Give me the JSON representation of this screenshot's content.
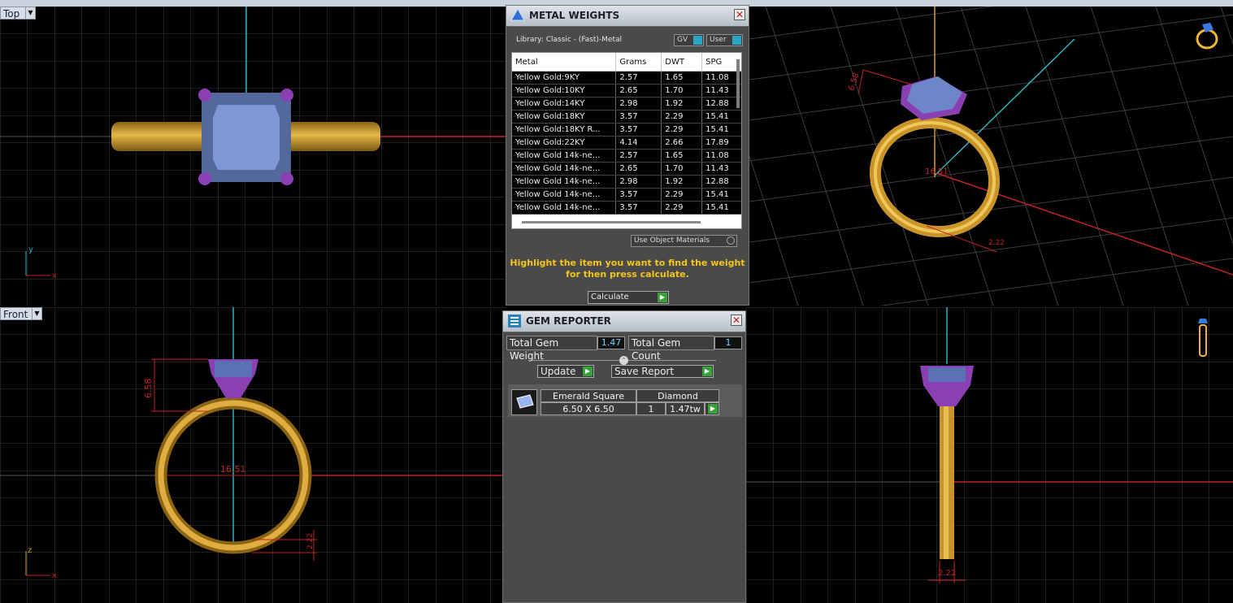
{
  "viewports": {
    "top_label": "Top",
    "front_label": "Front",
    "axis_x": "x",
    "axis_y": "y",
    "axis_z": "z"
  },
  "dimensions": {
    "front_height": "6.58",
    "front_width": "16.51",
    "persp_height": "6.58",
    "persp_width": "16.51",
    "persp_band": "2.22",
    "side_band": "2.22"
  },
  "metal_weights": {
    "title": "METAL WEIGHTS",
    "library": "Library: Classic - (Fast)-Metal",
    "gv_label": "GV",
    "user_label": "User",
    "columns": [
      "Metal",
      "Grams",
      "DWT",
      "SPG"
    ],
    "rows": [
      [
        "Yellow Gold:9KY",
        "2.57",
        "1.65",
        "11.08"
      ],
      [
        "Yellow Gold:10KY",
        "2.65",
        "1.70",
        "11.43"
      ],
      [
        "Yellow Gold:14KY",
        "2.98",
        "1.92",
        "12.88"
      ],
      [
        "Yellow Gold:18KY",
        "3.57",
        "2.29",
        "15.41"
      ],
      [
        "Yellow Gold:18KY R...",
        "3.57",
        "2.29",
        "15.41"
      ],
      [
        "Yellow Gold:22KY",
        "4.14",
        "2.66",
        "17.89"
      ],
      [
        "Yellow Gold 14k-ne...",
        "2.57",
        "1.65",
        "11.08"
      ],
      [
        "Yellow Gold 14k-ne...",
        "2.65",
        "1.70",
        "11.43"
      ],
      [
        "Yellow Gold 14k-ne...",
        "2.98",
        "1.92",
        "12.88"
      ],
      [
        "Yellow Gold 14k-ne...",
        "3.57",
        "2.29",
        "15.41"
      ],
      [
        "Yellow Gold 14k-ne...",
        "3.57",
        "2.29",
        "15.41"
      ]
    ],
    "use_object_materials": "Use Object Materials",
    "hint_line1": "Highlight the item you want to find the weight",
    "hint_line2": "for then press calculate.",
    "calculate_label": "Calculate"
  },
  "gem_reporter": {
    "title": "GEM REPORTER",
    "total_weight_label": "Total Gem Weight",
    "total_weight_value": "1.47",
    "total_count_label": "Total Gem Count",
    "total_count_value": "1",
    "update_label": "Update",
    "save_report_label": "Save Report",
    "gem": {
      "shape": "Emerald Square",
      "material": "Diamond",
      "size": "6.50 X 6.50",
      "count": "1",
      "weight": "1.47tw"
    }
  },
  "colors": {
    "grid": "#3d3d3d",
    "grid_major": "#5a5a5a",
    "gold": "#c9952a",
    "stone": "#6c86c8",
    "prong": "#8a3fb3",
    "axis_red": "#c42222",
    "axis_cyan": "#2fb3c4",
    "hint": "#f5c518"
  }
}
